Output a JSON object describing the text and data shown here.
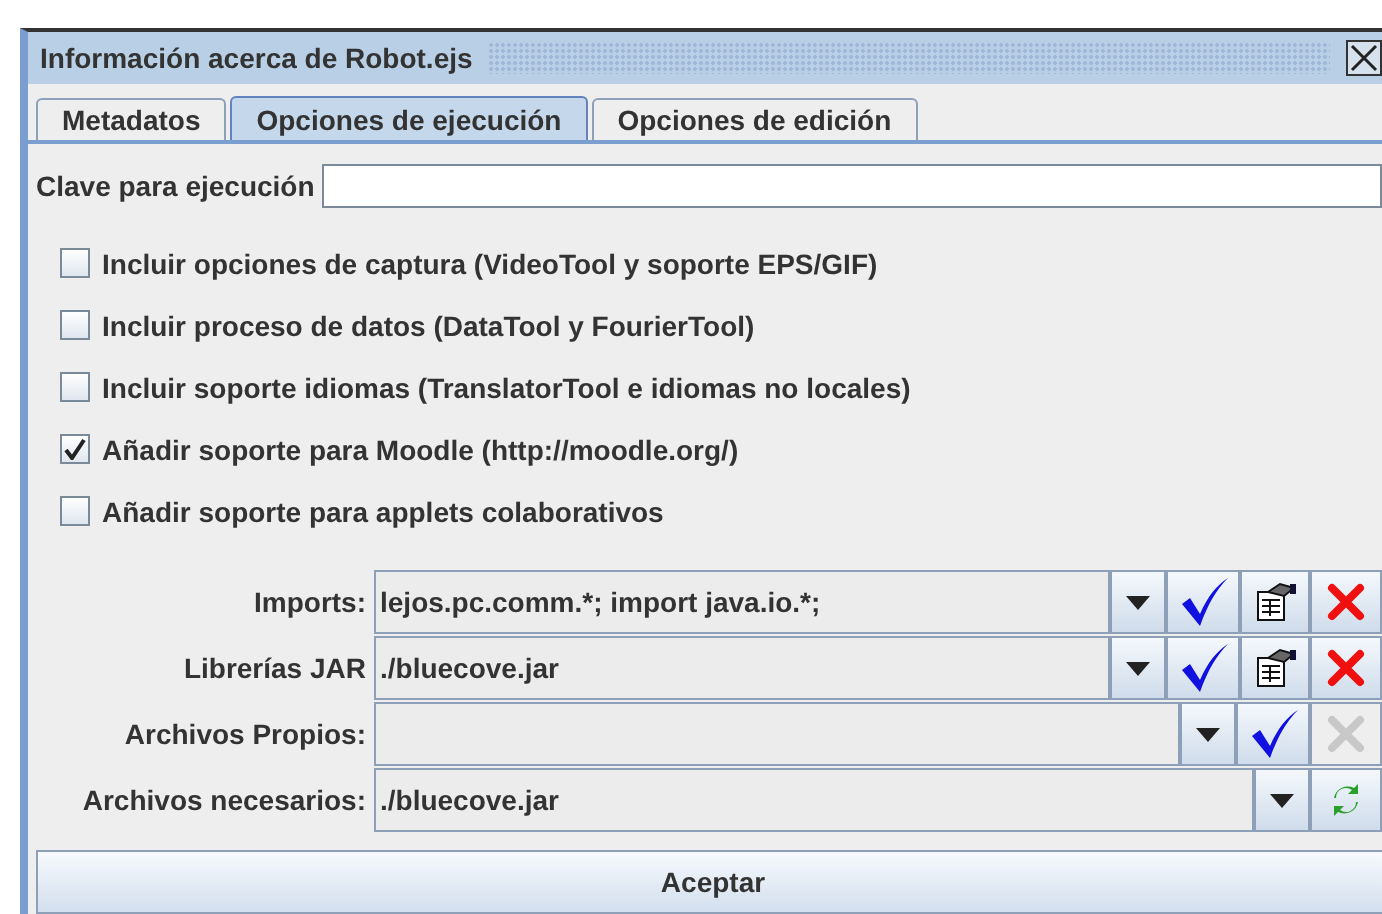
{
  "window": {
    "title": "Información acerca de Robot.ejs"
  },
  "tabs": [
    {
      "label": "Metadatos",
      "selected": false
    },
    {
      "label": "Opciones de ejecución",
      "selected": true
    },
    {
      "label": "Opciones de edición",
      "selected": false
    }
  ],
  "key_field": {
    "label": "Clave para ejecución"
  },
  "options": [
    {
      "label": "Incluir opciones de captura (VideoTool y soporte EPS/GIF)",
      "checked": false
    },
    {
      "label": "Incluir proceso de datos (DataTool y FourierTool)",
      "checked": false
    },
    {
      "label": "Incluir soporte idiomas (TranslatorTool e idiomas no locales)",
      "checked": false
    },
    {
      "label": "Añadir soporte para Moodle (http://moodle.org/)",
      "checked": true
    },
    {
      "label": "Añadir soporte para applets colaborativos",
      "checked": false
    }
  ],
  "file_rows": [
    {
      "label": "Imports:",
      "value": "lejos.pc.comm.*; import java.io.*;",
      "buttons": [
        {
          "kind": "confirm",
          "disabled": false
        },
        {
          "kind": "properties",
          "disabled": false
        },
        {
          "kind": "delete",
          "disabled": false
        }
      ]
    },
    {
      "label": "Librerías JAR",
      "value": "./bluecove.jar",
      "buttons": [
        {
          "kind": "confirm",
          "disabled": false
        },
        {
          "kind": "properties",
          "disabled": false
        },
        {
          "kind": "delete",
          "disabled": false
        }
      ]
    },
    {
      "label": "Archivos Propios:",
      "buttons": [
        {
          "kind": "confirm",
          "disabled": false
        },
        {
          "kind": "delete",
          "disabled": true
        }
      ]
    },
    {
      "label": "Archivos necesarios:",
      "value": "./bluecove.jar",
      "buttons": [
        {
          "kind": "refresh",
          "disabled": false
        }
      ]
    }
  ],
  "accept_button": {
    "label": "Aceptar"
  }
}
